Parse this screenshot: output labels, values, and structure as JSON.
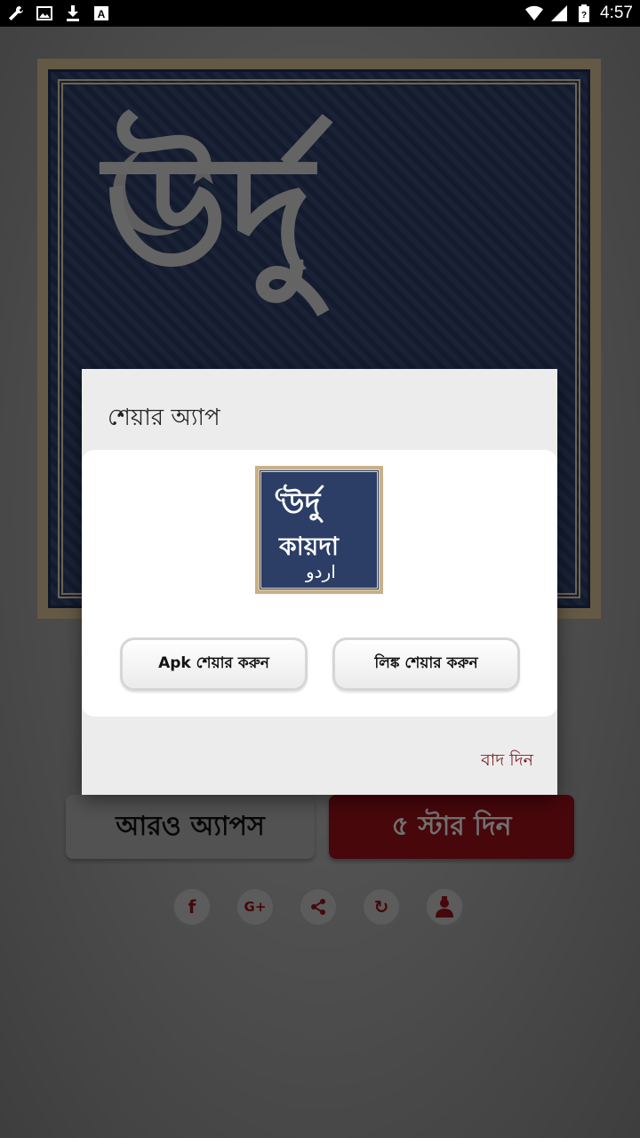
{
  "status_bar": {
    "left_icons": [
      "wrench-icon",
      "image-icon",
      "download-icon",
      "font-a-icon"
    ],
    "right_icons": [
      "wifi-icon",
      "signal-icon",
      "battery-icon"
    ],
    "time": "4:57"
  },
  "background": {
    "banner_text": "উর্দু",
    "more_apps_label": "আরও অ্যাপস",
    "rate_label": "৫ স্টার দিন",
    "social_icons": [
      "facebook-icon",
      "google-plus-icon",
      "share-icon",
      "refresh-icon",
      "privacy-icon"
    ],
    "social_glyphs": [
      "f",
      "G+",
      "⋖",
      "↻",
      "☗"
    ]
  },
  "dialog": {
    "title": "শেয়ার অ্যাপ",
    "icon": {
      "line1": "উর্দু",
      "line2": "কায়দা",
      "line3": "اردو"
    },
    "apk_button": "Apk শেয়ার করুন",
    "link_button": "লিঙ্ক শেয়ার করুন",
    "dismiss": "বাদ দিন"
  },
  "colors": {
    "accent": "#8e0f16",
    "dismiss_text": "#7a1a22",
    "banner_blue": "#2a3a63"
  }
}
